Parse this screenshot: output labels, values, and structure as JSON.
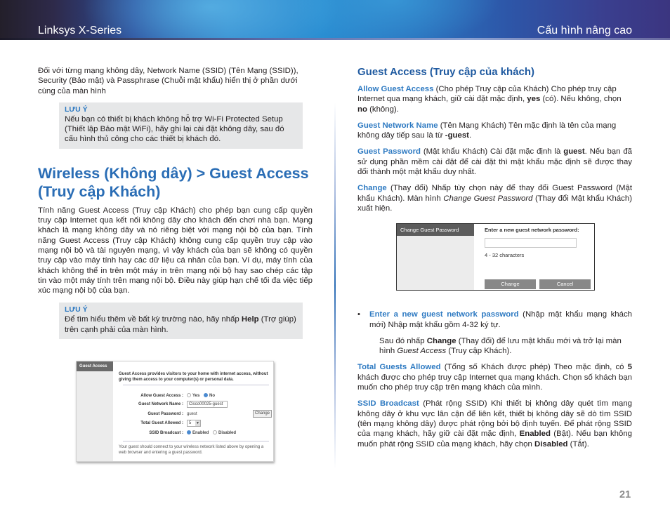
{
  "header": {
    "product": "Linksys X-Series",
    "section": "Cấu hình nâng cao"
  },
  "left": {
    "intro": "Đối với từng mạng không dây, Network Name (SSID) (Tên Mạng (SSID)), Security (Bảo mật) và Passphrase (Chuỗi mật khẩu) hiển thị ở phần dưới cùng của màn hình",
    "note1": {
      "title": "LƯU Ý",
      "text": "Nếu bạn có thiết bị khách không hỗ trợ Wi-Fi Protected Setup (Thiết lập Bảo mật WiFi), hãy ghi lại cài đặt không dây, sau đó cấu hình thủ công cho các thiết bị khách đó."
    },
    "heading": "Wireless (Không dây) > Guest Access (Truy cập Khách)",
    "body": "Tính năng Guest Access (Truy cập Khách) cho phép bạn cung cấp quyền truy cập Internet qua kết nối không dây cho khách đến chơi nhà bạn. Mạng khách là mạng không dây và nó riêng biệt với mạng nội bộ của bạn. Tính năng Guest Access (Truy cập Khách) không cung cấp quyền truy cập vào mạng nội bộ và tài nguyên mạng, vì vậy khách của bạn sẽ không có quyền truy cập vào máy tính hay các dữ liệu cá nhân của bạn. Ví dụ, máy tính của khách không thể in trên một máy in trên mạng nội bộ hay sao chép các tập tin vào một máy tính trên mạng nội bộ. Điều này giúp hạn chế tối đa việc tiếp xúc mạng nội bộ của bạn.",
    "note2": {
      "title": "LƯU Ý",
      "text_before": "Để tìm hiểu thêm về bất kỳ trường nào, hãy nhấp ",
      "bold": "Help",
      "text_after": " (Trợ giúp) trên cạnh phải của màn hình."
    },
    "screenshot": {
      "sidebar_title": "Guest Access",
      "intro": "Guest Access provides visitors to your home with internet access, without giving them access to your computer(s) or personal data.",
      "fields": {
        "allow_label": "Allow Guest Access :",
        "allow_yes": "Yes",
        "allow_no": "No",
        "name_label": "Guest Network Name :",
        "name_value": "Cisco00025-guest",
        "password_label": "Guest Password :",
        "password_value": "guest",
        "change_button": "Change",
        "total_label": "Total Guest Allowed :",
        "total_value": "5",
        "ssid_label": "SSID Broadcast :",
        "ssid_enabled": "Enabled",
        "ssid_disabled": "Disabled"
      },
      "footer": "Your guest should connect to your wireless network listed above by opening a web browser and entering a guest password."
    }
  },
  "right": {
    "heading": "Guest Access (Truy cập của khách)",
    "allow": {
      "term": "Allow Guest Access",
      "t1": " (Cho phép Truy cập của Khách)  Cho phép truy cập Internet qua mạng khách, giữ cài đặt mặc định, ",
      "b1": "yes",
      "t2": " (có). Nếu không, chọn ",
      "b2": "no",
      "t3": " (không)."
    },
    "network_name": {
      "term": "Guest Network Name",
      "t1": " (Tên Mạng Khách)  Tên mặc định là tên của mạng không dây tiếp sau là từ ",
      "b1": "-guest",
      "t2": "."
    },
    "password": {
      "term": "Guest Password",
      "t1": "  (Mật khẩu Khách) Cài đặt mặc định là ",
      "b1": "guest",
      "t2": ". Nếu bạn đã sử dụng phần mềm cài đặt để cài đặt thì mật khẩu mặc định sẽ được thay đổi thành một mật khẩu duy nhất."
    },
    "change": {
      "term": "Change",
      "t1": " (Thay đổi)  Nhấp tùy chọn này để thay đổi Guest Password (Mật khẩu Khách). Màn hình ",
      "i1": "Change Guest Password",
      "t2": " (Thay đổi Mật khẩu Khách) xuất hiện."
    },
    "screenshot": {
      "sidebar_title": "Change Guest Password",
      "prompt": "Enter a new guest network password:",
      "input_value": "",
      "hint": "4 - 32 characters",
      "change_button": "Change",
      "cancel_button": "Cancel"
    },
    "bullet": {
      "marker": "•",
      "term": "Enter a new guest network password",
      "t1": " (Nhập mật khẩu mạng khách mới)  Nhập mật khẩu gồm 4-32 ký tự."
    },
    "after": {
      "t1": "Sau đó nhấp ",
      "b1": "Change",
      "t2": " (Thay đổi) để lưu mật khẩu mới và trở lại màn hình ",
      "i1": "Guest Access",
      "t3": " (Truy cập Khách)."
    },
    "total": {
      "term": "Total Guests Allowed",
      "t1": " (Tổng số Khách được phép)  Theo mặc định, có ",
      "b1": "5",
      "t2": " khách được cho phép truy cập Internet qua mạng khách. Chọn số khách bạn muốn cho phép truy cập trên mạng khách của mình."
    },
    "ssid": {
      "term": "SSID Broadcast",
      "t1": " (Phát rộng SSID)  Khi thiết bị không dây quét tìm mạng không dây ở khu vực lân cận để liên kết, thiết bị không dây sẽ dò tìm SSID (tên mạng không dây) được phát rộng bởi bộ định tuyến. Để phát rộng SSID của mạng khách, hãy giữ cài đặt mặc định, ",
      "b1": "Enabled",
      "t2": " (Bật). Nếu bạn không muốn phát rộng SSID của mạng khách, hãy chọn ",
      "b2": "Disabled",
      "t3": " (Tắt)."
    }
  },
  "footer": {
    "page_number": "21"
  }
}
